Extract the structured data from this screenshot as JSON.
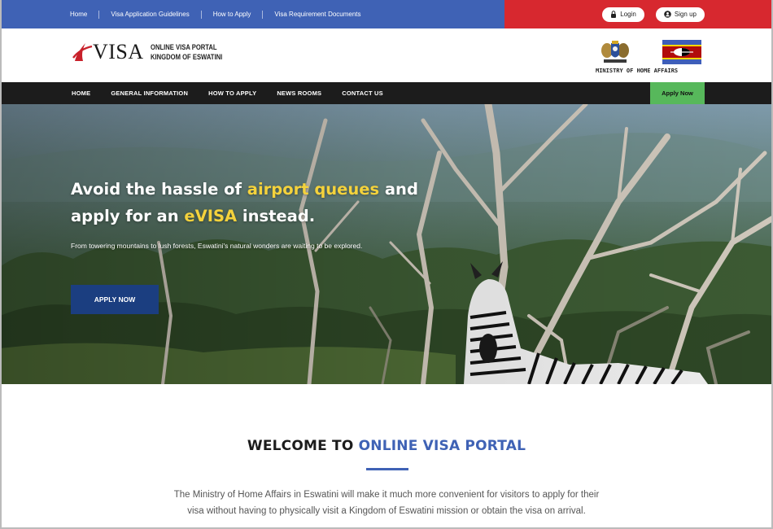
{
  "topbar": {
    "links": [
      "Home",
      "Visa Application Guidelines",
      "How to Apply",
      "Visa Requirement Documents"
    ],
    "login_label": "Login",
    "signup_label": "Sign up"
  },
  "header": {
    "logo_main": "VISA",
    "logo_line1": "ONLINE VISA PORTAL",
    "logo_line2": "KINGDOM OF ESWATINI",
    "ministry_label": "MINISTRY OF HOME AFFAIRS"
  },
  "nav": {
    "items": [
      "HOME",
      "GENERAL INFORMATION",
      "HOW TO APPLY",
      "NEWS ROOMS",
      "CONTACT US"
    ],
    "apply_label": "Apply Now"
  },
  "hero": {
    "title_1": "Avoid the hassle of ",
    "title_hl1": "airport queues",
    "title_2": " and apply for an ",
    "title_hl2": "eVISA",
    "title_3": " instead.",
    "subtitle": "From towering mountains to lush forests, Eswatini's natural wonders are waiting to be explored.",
    "button_label": "APPLY NOW"
  },
  "welcome": {
    "title_1": "WELCOME TO ",
    "title_hl": "ONLINE VISA PORTAL",
    "body": "The Ministry of Home Affairs in Eswatini will make it much more convenient for visitors to apply for their visa without having to physically visit a Kingdom of Eswatini mission or obtain the visa on arrival."
  },
  "colors": {
    "topbar_blue": "#3f62b5",
    "topbar_red": "#d7282f",
    "nav_dark": "#1c1c1c",
    "apply_green": "#57b85b",
    "hero_highlight": "#f4d23c",
    "button_navy": "#1b3e80"
  },
  "icons": [
    "lock-icon",
    "user-icon",
    "evisa-swoosh-icon",
    "coat-of-arms-icon",
    "eswatini-flag-icon"
  ]
}
